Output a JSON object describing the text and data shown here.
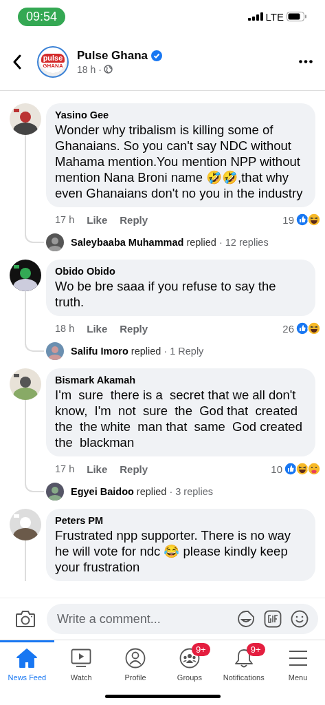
{
  "status_bar": {
    "time": "09:54",
    "network": "LTE"
  },
  "header": {
    "logo_top": "pulse",
    "logo_bottom": "GHANA",
    "page_name": "Pulse Ghana",
    "verified": true,
    "time": "18 h ·"
  },
  "comments": [
    {
      "author": "Yasino Gee",
      "text": "Wonder why tribalism is killing some of Ghanaians. So you can't say NDC without Mahama mention.You mention NPP without mention Nana Broni name 🤣🤣,that why even Ghanaians don't no you in the industry",
      "time": "17 h",
      "like": "Like",
      "reply": "Reply",
      "reaction_count": "19",
      "reactions": [
        {
          "kind": "like"
        },
        {
          "kind": "haha"
        }
      ],
      "replies": {
        "name": "Saleybaaba Muhammad",
        "verb": "replied",
        "count": "· 12 replies"
      }
    },
    {
      "author": "Obido Obido",
      "text": "Wo be bre saaa if you refuse to say the truth.",
      "time": "18 h",
      "like": "Like",
      "reply": "Reply",
      "reaction_count": "26",
      "reactions": [
        {
          "kind": "like"
        },
        {
          "kind": "haha"
        }
      ],
      "replies": {
        "name": "Salifu Imoro",
        "verb": "replied",
        "count": "· 1 Reply"
      }
    },
    {
      "author": "Bismark Akamah",
      "text": "I'm  sure  there is a  secret that we all don't know,  I'm  not  sure  the  God that  created the  the white  man that  same  God created the  blackman",
      "time": "17 h",
      "like": "Like",
      "reply": "Reply",
      "reaction_count": "10",
      "reactions": [
        {
          "kind": "like"
        },
        {
          "kind": "haha"
        },
        {
          "kind": "care"
        }
      ],
      "replies": {
        "name": "Egyei Baidoo",
        "verb": "replied",
        "count": "· 3 replies"
      }
    },
    {
      "author": "Peters PM",
      "text": "Frustrated npp supporter. There is no way he will vote for ndc 😂 please kindly keep your frustration"
    }
  ],
  "composer": {
    "placeholder": "Write a comment..."
  },
  "tabs": [
    {
      "kind": "home",
      "label": "News Feed",
      "selected": true
    },
    {
      "kind": "watch",
      "label": "Watch",
      "selected": false
    },
    {
      "kind": "profile",
      "label": "Profile",
      "selected": false
    },
    {
      "kind": "groups",
      "label": "Groups",
      "selected": false,
      "badge": "9+"
    },
    {
      "kind": "bell",
      "label": "Notifications",
      "selected": false,
      "badge": "9+"
    },
    {
      "kind": "menu",
      "label": "Menu",
      "selected": false
    }
  ]
}
